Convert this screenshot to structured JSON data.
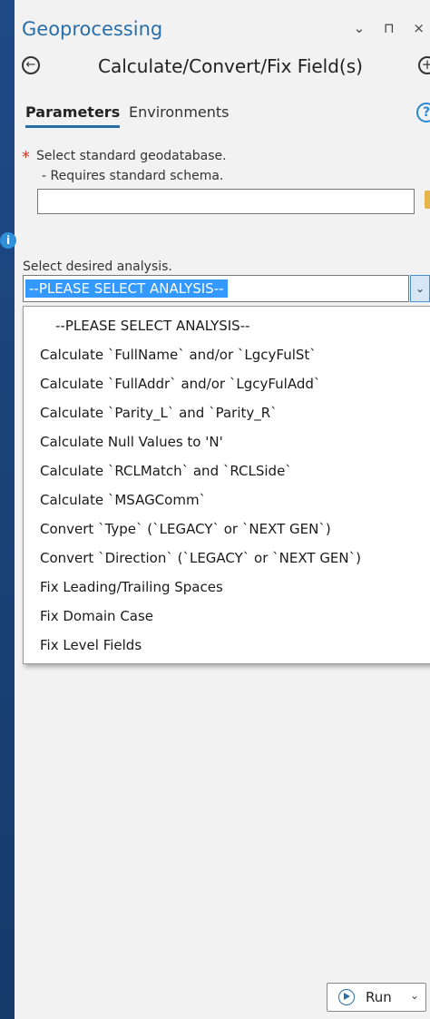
{
  "pane": {
    "title": "Geoprocessing",
    "controls": "⌄ ⊓ ×"
  },
  "tool": {
    "title": "Calculate/Convert/Fix Field(s)"
  },
  "tabs": {
    "parameters": "Parameters",
    "environments": "Environments"
  },
  "params": {
    "gdb_label": "Select standard geodatabase.",
    "gdb_sublabel": "- Requires standard schema.",
    "gdb_value": "",
    "analysis_label": "Select desired analysis.",
    "analysis_selected": "--PLEASE SELECT ANALYSIS--"
  },
  "dropdown": {
    "options": [
      "--PLEASE SELECT ANALYSIS--",
      "Calculate `FullName` and/or `LgcyFulSt`",
      "Calculate `FullAddr` and/or `LgcyFulAdd`",
      "Calculate `Parity_L` and `Parity_R`",
      "Calculate Null Values to 'N'",
      "Calculate `RCLMatch` and `RCLSide`",
      "Calculate `MSAGComm`",
      "Convert `Type` (`LEGACY` or `NEXT GEN`)",
      "Convert `Direction` (`LEGACY` or `NEXT GEN`)",
      "Fix Leading/Trailing Spaces",
      "Fix Domain Case",
      "Fix Level Fields"
    ]
  },
  "footer": {
    "run_label": "Run"
  },
  "colors": {
    "accent": "#2a6ea8",
    "selection": "#3399ff",
    "required": "#d43a2a"
  }
}
